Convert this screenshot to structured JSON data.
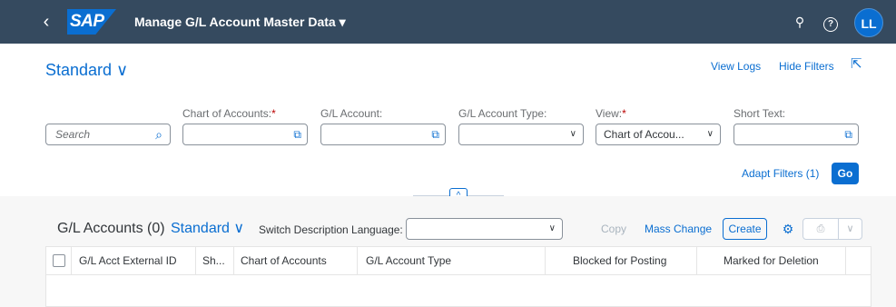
{
  "shell": {
    "back_icon": "‹",
    "logo": "SAP",
    "app_title": "Manage G/L Account Master Data ▾",
    "search_icon": "⚲",
    "help_icon": "?",
    "avatar": "LL"
  },
  "header": {
    "variant": "Standard ∨",
    "view_logs": "View Logs",
    "hide_filters": "Hide Filters",
    "share_icon": "⇱"
  },
  "filters": {
    "search_placeholder": "Search",
    "chart_of_accounts_label": "Chart of Accounts:",
    "gl_account_label": "G/L Account:",
    "gl_account_type_label": "G/L Account Type:",
    "view_label": "View:",
    "view_value": "Chart of Accou...",
    "short_text_label": "Short Text:",
    "required_marker": "*",
    "value_help_icon": "⧉",
    "dropdown_icon": "∨",
    "adapt_filters": "Adapt Filters (1)",
    "go": "Go"
  },
  "collapse_icon": "^",
  "table": {
    "title": "G/L Accounts (0)",
    "variant": "Standard ∨",
    "switch_language_label": "Switch Description Language:",
    "copy": "Copy",
    "mass_change": "Mass Change",
    "create": "Create",
    "settings_icon": "⚙",
    "export_icon": "⎙",
    "export_menu_icon": "∨",
    "columns": [
      "G/L Acct External ID",
      "Sh...",
      "Chart of Accounts",
      "G/L Account Type",
      "Blocked for Posting",
      "Marked for Deletion"
    ]
  },
  "colors": {
    "shell_bg": "#354a5f",
    "accent": "#0a6ed1",
    "required": "#bb0000"
  }
}
